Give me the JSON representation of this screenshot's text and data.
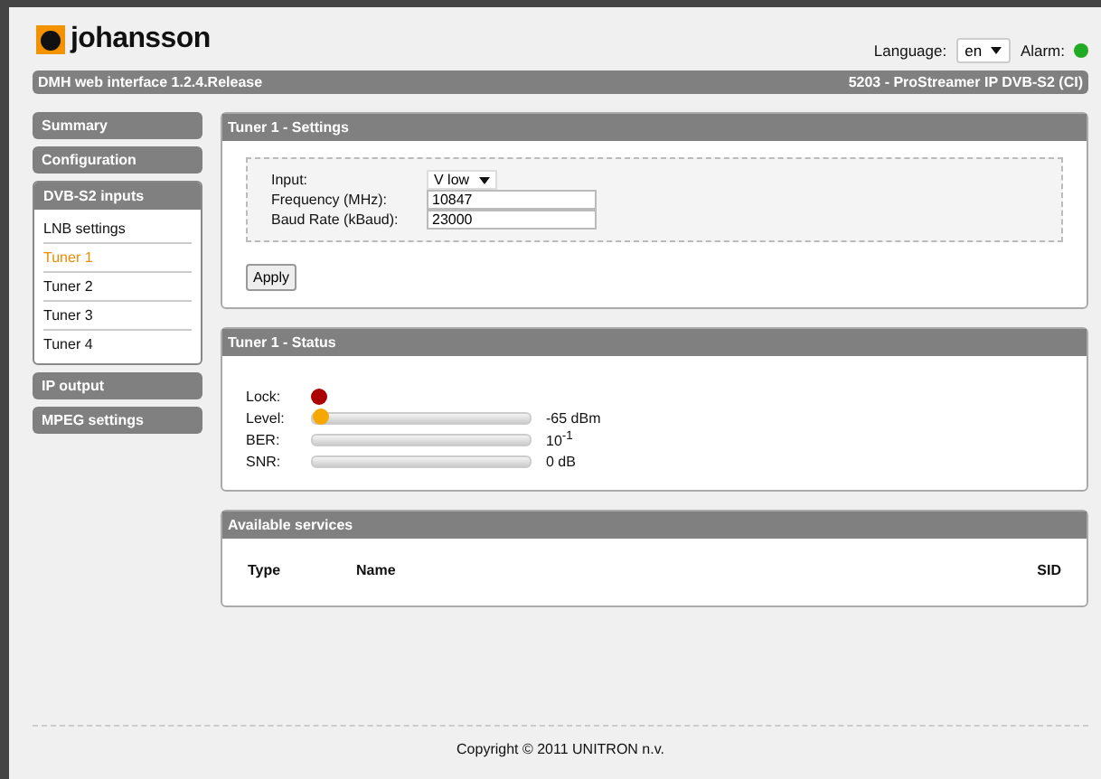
{
  "header": {
    "brand": "johansson",
    "language_label": "Language:",
    "language": "en",
    "alarm_label": "Alarm:",
    "alarm_active": false
  },
  "title_bar": {
    "left": "DMH web interface 1.2.4.Release",
    "right": "5203 - ProStreamer IP DVB-S2 (CI)"
  },
  "sidebar": [
    {
      "label": "Summary",
      "expanded": false
    },
    {
      "label": "Configuration",
      "expanded": false
    },
    {
      "label": "DVB-S2 inputs",
      "expanded": true,
      "children": [
        {
          "label": "LNB settings",
          "selected": false
        },
        {
          "label": "Tuner 1",
          "selected": true
        },
        {
          "label": "Tuner 2",
          "selected": false
        },
        {
          "label": "Tuner 3",
          "selected": false
        },
        {
          "label": "Tuner 4",
          "selected": false
        }
      ]
    },
    {
      "label": "IP output",
      "expanded": false
    },
    {
      "label": "MPEG settings",
      "expanded": false
    }
  ],
  "settings": {
    "title": "Tuner 1 - Settings",
    "fields": [
      {
        "kind": "select",
        "label": "Input:",
        "value": "V low"
      },
      {
        "kind": "text",
        "label": "Frequency (MHz):",
        "value": "10847"
      },
      {
        "kind": "text",
        "label": "Baud Rate (kBaud):",
        "value": "23000"
      }
    ],
    "button": "Apply"
  },
  "status": {
    "title": "Tuner 1 - Status",
    "lock_label": "Lock:",
    "locked": false,
    "meters": [
      {
        "label": "Level:",
        "level": 0,
        "reading": "-65 dBm"
      },
      {
        "label": "BER:",
        "reading": "10$^{-1}$"
      },
      {
        "label": "SNR:",
        "reading": "0 dB"
      }
    ]
  },
  "services": {
    "title": "Available services",
    "columns": [
      "Type",
      "Name",
      "SID"
    ]
  },
  "footer": "Copyright © 2011 UNITRON n.v."
}
